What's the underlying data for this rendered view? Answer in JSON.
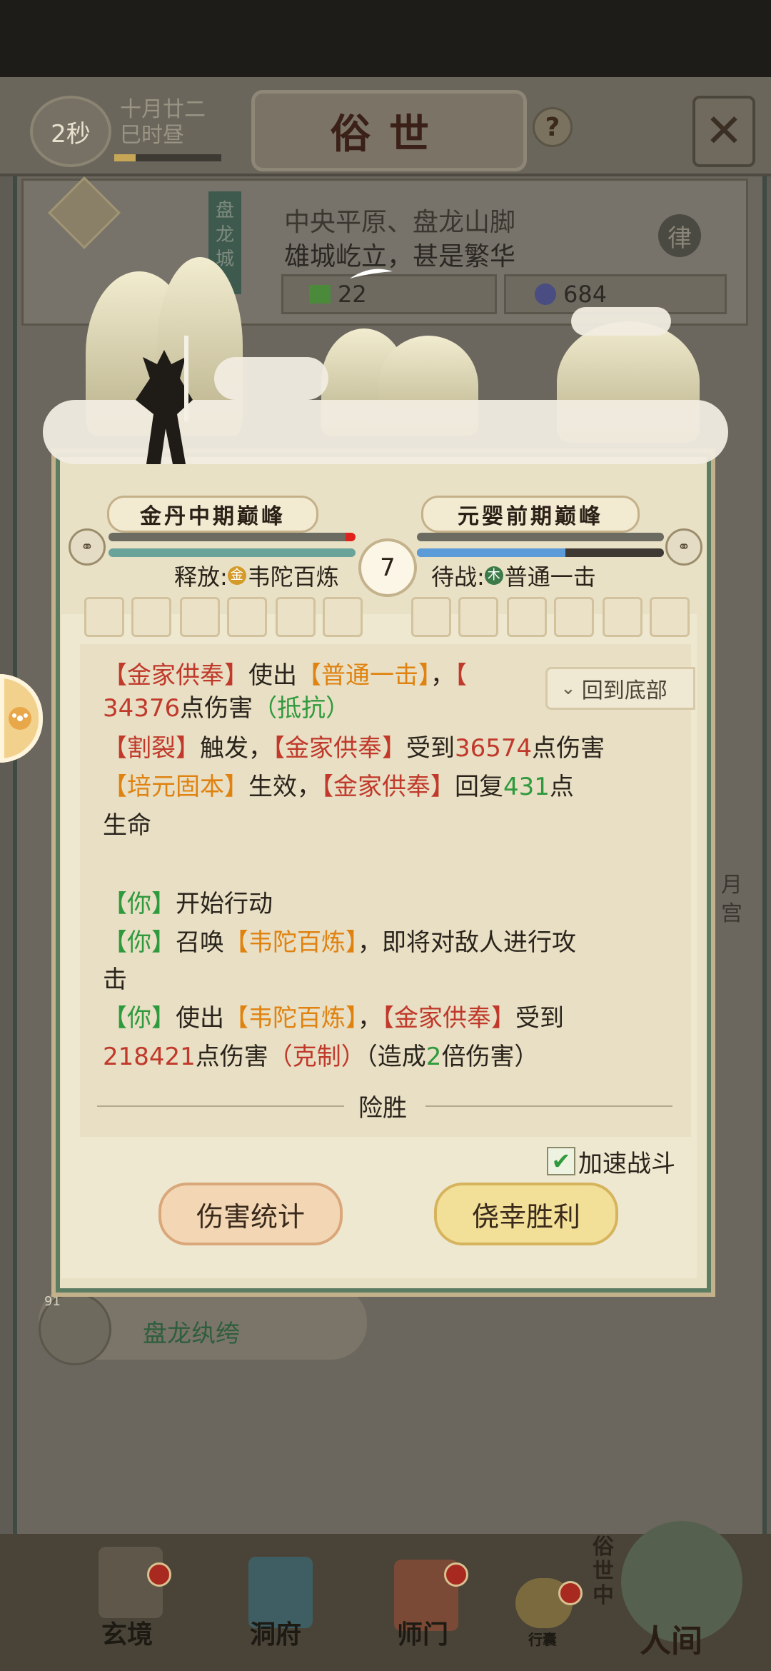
{
  "header": {
    "timer": "2秒",
    "date_line1": "十月廿二",
    "date_line2": "巳时昼",
    "title": "俗世",
    "help": "?"
  },
  "location": {
    "city": "盘龙城",
    "region": "中央平原、盘龙山脚",
    "description": "雄城屹立，甚是繁华",
    "stat1": "22",
    "stat2": "684",
    "mark": "律"
  },
  "battle": {
    "left_rank": "金丹中期巅峰",
    "right_rank": "元婴前期巅峰",
    "left_hp": 0.04,
    "right_hp": 1.0,
    "left_mp": 1.0,
    "right_mp": 0.6,
    "left_action_label": "释放:",
    "left_action_element": "金",
    "left_action_skill": "韦陀百炼",
    "right_action_label": "待战:",
    "right_action_element": "木",
    "right_action_skill": "普通一击",
    "round": "7",
    "back_to_bottom": "回到底部",
    "log": {
      "l1": {
        "a": "【金家供奉】",
        "b": "使出",
        "c": "【普通一击】",
        "d": "，",
        "e": "【"
      },
      "l2": {
        "a": "34376",
        "b": "点伤害",
        "c": "（抵抗）"
      },
      "l3": {
        "a": "【割裂】",
        "b": "触发，",
        "c": "【金家供奉】",
        "d": "受到",
        "e": "36574",
        "f": "点伤害"
      },
      "l4": {
        "a": "【培元固本】",
        "b": "生效，",
        "c": "【金家供奉】",
        "d": "回复",
        "e": "431",
        "f": "点"
      },
      "l5": {
        "a": "生命"
      },
      "l6": {
        "a": "【你】",
        "b": "开始行动"
      },
      "l7": {
        "a": "【你】",
        "b": "召唤",
        "c": "【韦陀百炼】",
        "d": "，即将对敌人进行攻"
      },
      "l8": {
        "a": "击"
      },
      "l9": {
        "a": "【你】",
        "b": "使出",
        "c": "【韦陀百炼】",
        "d": "，",
        "e": "【金家供奉】",
        "f": "受到"
      },
      "l10": {
        "a": "218421",
        "b": "点伤害",
        "c": "（克制）",
        "d": "（造成",
        "e": "2",
        "f": "倍伤害）"
      }
    },
    "outcome": "险胜",
    "speed_label": "加速战斗",
    "speed_checked": true,
    "damage_stats_button": "伤害统计",
    "victory_button": "侥幸胜利"
  },
  "side": {
    "chat_count": "91",
    "chat_name": "盘龙纨绔",
    "right_badge": "月宫"
  },
  "nav": {
    "items": [
      "玄境",
      "洞府",
      "师门",
      "行囊",
      "人间"
    ],
    "current": "俗世中"
  },
  "colors": {
    "damage_red": "#c0392b",
    "skill_orange": "#e0820f",
    "player_green": "#2f9a3d",
    "hp_red": "#e0221c",
    "hp_grey": "#6b6b62",
    "mp_teal": "#6aa39a",
    "mp_blue": "#5a9bd8"
  }
}
